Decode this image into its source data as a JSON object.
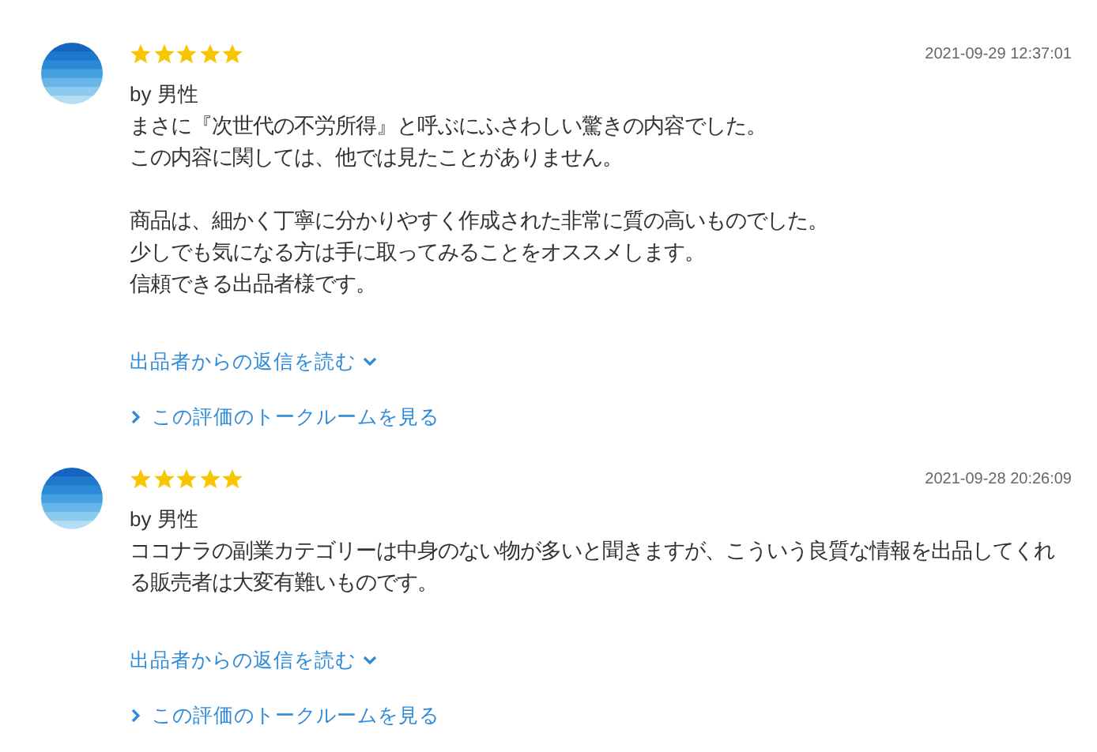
{
  "reviews": [
    {
      "stars": 5,
      "date": "2021-09-29 12:37:01",
      "author": "by 男性",
      "paragraphs": [
        [
          "まさに『次世代の不労所得』と呼ぶにふさわしい驚きの内容でした。",
          "この内容に関しては、他では見たことがありません。"
        ],
        [
          "商品は、細かく丁寧に分かりやすく作成された非常に質の高いものでした。",
          "少しでも気になる方は手に取ってみることをオススメします。",
          "信頼できる出品者様です。"
        ]
      ],
      "reply_link": "出品者からの返信を読む",
      "talkroom_link": "この評価のトークルームを見る"
    },
    {
      "stars": 5,
      "date": "2021-09-28 20:26:09",
      "author": "by 男性",
      "paragraphs": [
        [
          "ココナラの副業カテゴリーは中身のない物が多いと聞きますが、こういう良質な情報を出品してくれる販売者は大変有難いものです。"
        ]
      ],
      "reply_link": "出品者からの返信を読む",
      "talkroom_link": "この評価のトークルームを見る"
    }
  ]
}
